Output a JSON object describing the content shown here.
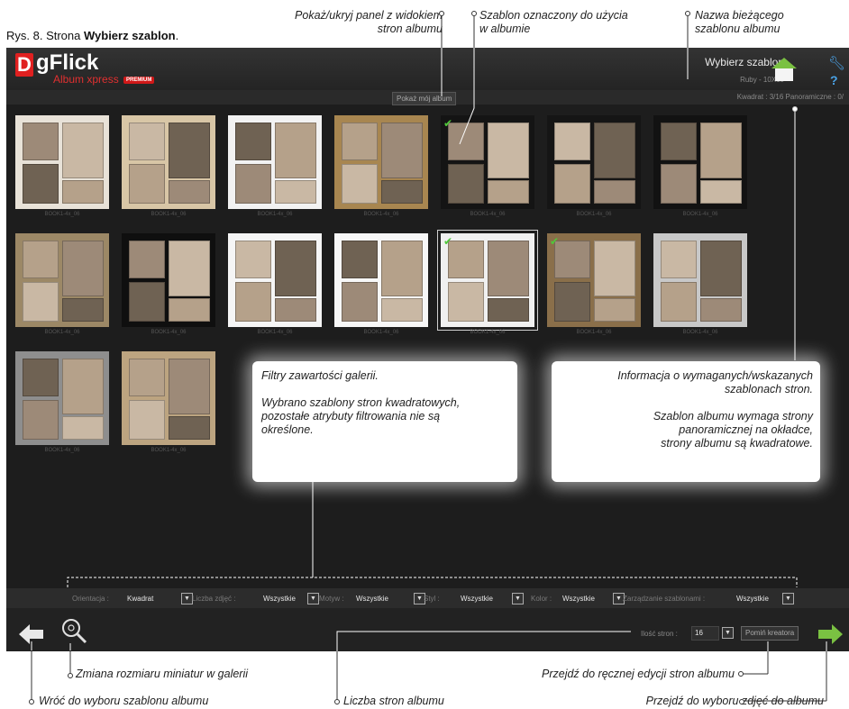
{
  "caption": {
    "prefix": "Rys. 8. Strona ",
    "bold": "Wybierz szablon",
    "suffix": "."
  },
  "callouts": {
    "toggle_panel": [
      "Pokaż/ukryj panel z widokiem",
      "stron albumu"
    ],
    "selected_template": [
      "Szablon oznaczony do użycia",
      "w albumie"
    ],
    "template_name": [
      "Nazwa bieżącego",
      "szablonu albumu"
    ],
    "filters": [
      "Filtry zawartości galerii.",
      "",
      "Wybrano szablony stron kwadratowych,",
      "pozostałe atrybuty filtrowania nie są",
      "określone."
    ],
    "info": [
      "Informacja o wymaganych/wskazanych",
      "szablonach stron.",
      "",
      "Szablon albumu wymaga strony",
      "panoramicznej na okładce,",
      "strony albumu są kwadratowe."
    ],
    "thumb_size": "Zmiana rozmiaru miniatur w galerii",
    "manual_edit": "Przejdź do ręcznej edycji stron albumu",
    "back": "Wróć do wyboru szablonu albumu",
    "page_count": "Liczba stron albumu",
    "photos": "Przejdź do wyboru zdjęć do albumu"
  },
  "app": {
    "logo_initial": "D",
    "logo_text": "gFlick",
    "logo_sub": "Album xpress",
    "logo_badge": "PREMIUM",
    "title": "Wybierz szablon",
    "template_name": "Ruby - 10X10",
    "show_album_button": "Pokaż mój album",
    "page_info": "Kwadrat : 3/16  Panoramiczne : 0/",
    "thumbnails": [
      {
        "label": "BOOK1-4x_06",
        "checked": false,
        "selected": false,
        "bg": "#e8e2d8"
      },
      {
        "label": "BOOK1-4x_06",
        "checked": false,
        "selected": false,
        "bg": "#d8c6a6"
      },
      {
        "label": "BOOK1-4x_06",
        "checked": false,
        "selected": false,
        "bg": "#f2f2f2"
      },
      {
        "label": "BOOK1-4x_06",
        "checked": false,
        "selected": false,
        "bg": "#a88650"
      },
      {
        "label": "BOOK1-4x_06",
        "checked": true,
        "selected": false,
        "bg": "#141414"
      },
      {
        "label": "BOOK1-4x_06",
        "checked": false,
        "selected": false,
        "bg": "#151515"
      },
      {
        "label": "BOOK1-4x_06",
        "checked": false,
        "selected": false,
        "bg": "#121212"
      },
      {
        "label": "BOOK1-4x_06",
        "checked": false,
        "selected": false,
        "bg": "#9c8866"
      },
      {
        "label": "BOOK1-4x_06",
        "checked": false,
        "selected": false,
        "bg": "#0f0f0f"
      },
      {
        "label": "BOOK1-4x_06",
        "checked": false,
        "selected": false,
        "bg": "#f5f5f5"
      },
      {
        "label": "BOOK1-4x_06",
        "checked": false,
        "selected": false,
        "bg": "#f7f7f7"
      },
      {
        "label": "BOOK1-4x_06",
        "checked": true,
        "selected": true,
        "bg": "#f0f0f0"
      },
      {
        "label": "BOOK1-4x_06",
        "checked": true,
        "selected": false,
        "bg": "#8a6f4a"
      },
      {
        "label": "BOOK1-4x_06",
        "checked": false,
        "selected": false,
        "bg": "#c8c8c8"
      },
      {
        "label": "BOOK1-4x_06",
        "checked": false,
        "selected": false,
        "bg": "#8e8e8e"
      },
      {
        "label": "BOOK1-4x_06",
        "checked": false,
        "selected": false,
        "bg": "#bca480"
      }
    ],
    "filters": [
      {
        "label": "Orientacja :",
        "value": "Kwadrat"
      },
      {
        "label": "Liczba zdjęć :",
        "value": "Wszystkie"
      },
      {
        "label": "Motyw :",
        "value": "Wszystkie"
      },
      {
        "label": "Styl :",
        "value": "Wszystkie"
      },
      {
        "label": "Kolor :",
        "value": "Wszystkie"
      },
      {
        "label": "Zarządzanie szablonami :",
        "value": "Wszystkie"
      }
    ],
    "pages_label": "Ilość stron :",
    "pages_value": "16",
    "skip_button": "Pomiń kreatora",
    "colors": {
      "accent_green": "#7ac142",
      "logo_red": "#e02020",
      "help_blue": "#4aa3e8"
    }
  }
}
